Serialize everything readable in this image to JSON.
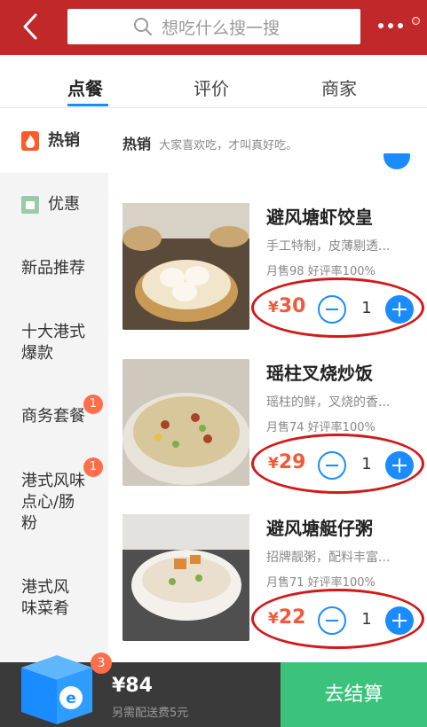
{
  "header": {
    "search_placeholder": "想吃什么搜一搜"
  },
  "tabs": [
    {
      "label": "点餐",
      "active": true
    },
    {
      "label": "评价",
      "active": false
    },
    {
      "label": "商家",
      "active": false
    }
  ],
  "sidebar": {
    "items": [
      {
        "label": "热销",
        "icon": "flame-icon",
        "active": true
      },
      {
        "label": "优惠",
        "icon": "coupon-icon",
        "active": false
      },
      {
        "label": "新品推荐",
        "active": false
      },
      {
        "label": "十大港式爆款",
        "active": false
      },
      {
        "label": "商务套餐",
        "badge": "1",
        "active": false
      },
      {
        "label": "港式风味点心/肠粉",
        "badge": "1",
        "active": false
      },
      {
        "label": "港式风味菜肴",
        "active": false
      }
    ]
  },
  "section": {
    "title": "热销",
    "subtitle": "大家喜欢吃，才叫真好吃。"
  },
  "items": [
    {
      "name": "避风塘虾饺皇",
      "desc": "手工特制，皮薄剔透...",
      "stats": "月售98  好评率100%",
      "currency": "¥",
      "price": "30",
      "qty": "1"
    },
    {
      "name": "瑶柱叉烧炒饭",
      "desc": "瑶柱的鲜，叉烧的香...",
      "stats": "月售74  好评率100%",
      "currency": "¥",
      "price": "29",
      "qty": "1"
    },
    {
      "name": "避风塘艇仔粥",
      "desc": "招牌靓粥，配料丰富...",
      "stats": "月售71  好评率100%",
      "currency": "¥",
      "price": "22",
      "qty": "1"
    }
  ],
  "cart": {
    "count": "3",
    "total": "¥84",
    "delivery_note": "另需配送费5元",
    "checkout_label": "去结算"
  },
  "colors": {
    "header": "#c0282a",
    "accent": "#1a8cff",
    "price": "#f05a3a",
    "checkout": "#3bc37c",
    "annotation_ring": "#d11a1a"
  }
}
